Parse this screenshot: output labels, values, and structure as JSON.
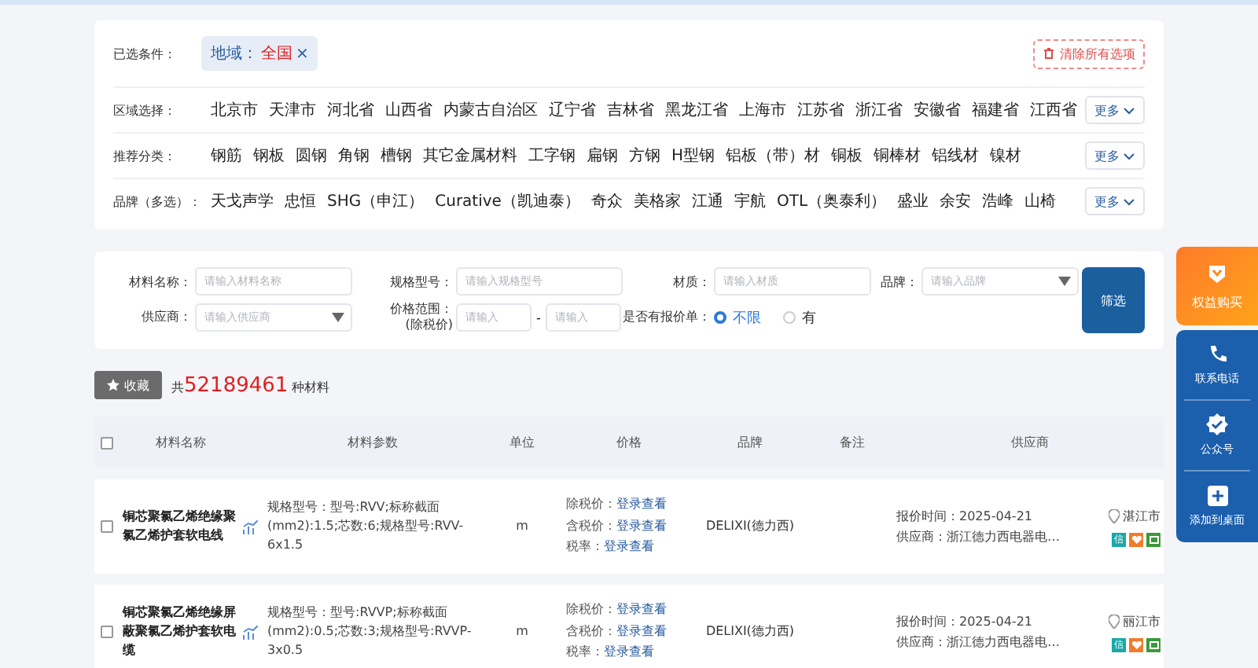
{
  "selected_conditions": {
    "label": "已选条件：",
    "tags": [
      {
        "key": "地域：",
        "value": "全国"
      }
    ],
    "close_glyph": "×",
    "clear_button": "清除所有选项"
  },
  "filter_rows": [
    {
      "label": "区域选择：",
      "options": [
        "北京市",
        "天津市",
        "河北省",
        "山西省",
        "内蒙古自治区",
        "辽宁省",
        "吉林省",
        "黑龙江省",
        "上海市",
        "江苏省",
        "浙江省",
        "安徽省",
        "福建省",
        "江西省"
      ],
      "more": "更多"
    },
    {
      "label": "推荐分类：",
      "options": [
        "钢筋",
        "钢板",
        "圆钢",
        "角钢",
        "槽钢",
        "其它金属材料",
        "工字钢",
        "扁钢",
        "方钢",
        "H型钢",
        "铝板（带）材",
        "铜板",
        "铜棒材",
        "铝线材",
        "镍材"
      ],
      "more": "更多"
    },
    {
      "label": "品牌（多选）：",
      "options": [
        "天戈声学",
        "忠恒",
        "SHG（申江）",
        "Curative（凯迪泰）",
        "奇众",
        "美格家",
        "江通",
        "宇航",
        "OTL（奥泰利）",
        "盛业",
        "余安",
        "浩峰",
        "山椅"
      ],
      "more": "更多"
    }
  ],
  "search_form": {
    "fields": [
      {
        "label": "材料名称：",
        "placeholder": "请输入材料名称",
        "kind": "text"
      },
      {
        "label": "规格型号：",
        "placeholder": "请输入规格型号",
        "kind": "text"
      },
      {
        "label": "材质：",
        "placeholder": "请输入材质",
        "kind": "text"
      },
      {
        "label": "品牌：",
        "placeholder": "请输入品牌",
        "kind": "select"
      },
      {
        "label": "供应商：",
        "placeholder": "请输入供应商",
        "kind": "select"
      }
    ],
    "price_range": {
      "label": "价格范围：",
      "sublabel": "(除税价)",
      "min_placeholder": "请输入",
      "separator": "-",
      "max_placeholder": "请输入"
    },
    "quote_filter": {
      "label": "是否有报价单：",
      "options": [
        {
          "label": "不限",
          "selected": true
        },
        {
          "label": "有",
          "selected": false
        }
      ]
    },
    "submit": "筛选"
  },
  "toolbar": {
    "favorite_button": "收藏",
    "count_prefix": "共",
    "count": "52189461",
    "count_suffix": "种材料"
  },
  "table": {
    "select_all_checked": false,
    "columns": [
      "材料名称",
      "材料参数",
      "单位",
      "价格",
      "品牌",
      "备注",
      "供应商"
    ],
    "rows": [
      {
        "checked": false,
        "name": "铜芯聚氯乙烯绝缘聚氯乙烯护套软电线",
        "params": "规格型号：型号:RVV;标称截面(mm2):1.5;芯数:6;规格型号:RVV-6x1.5",
        "unit": "m",
        "prices": [
          {
            "label": "除税价：",
            "link": "登录查看"
          },
          {
            "label": "含税价：",
            "link": "登录查看"
          },
          {
            "label": "税率：",
            "link": "登录查看"
          }
        ],
        "brand": "DELIXI(德力西)",
        "quote_time": "报价时间：2025-04-21",
        "supplier": "供应商：浙江德力西电器电…",
        "city": "湛江市",
        "badge_text": "信"
      },
      {
        "checked": false,
        "name": "铜芯聚氯乙烯绝缘屏蔽聚氯乙烯护套软电缆",
        "params": "规格型号：型号:RVVP;标称截面(mm2):0.5;芯数:3;规格型号:RVVP-3x0.5",
        "unit": "m",
        "prices": [
          {
            "label": "除税价：",
            "link": "登录查看"
          },
          {
            "label": "含税价：",
            "link": "登录查看"
          },
          {
            "label": "税率：",
            "link": "登录查看"
          }
        ],
        "brand": "DELIXI(德力西)",
        "quote_time": "报价时间：2025-04-21",
        "supplier": "供应商：浙江德力西电器电…",
        "city": "丽江市",
        "badge_text": "信"
      }
    ]
  },
  "side_panel": [
    {
      "label": "权益购买",
      "kind": "benefit"
    },
    {
      "label": "联系电话",
      "kind": "phone"
    },
    {
      "label": "公众号",
      "kind": "badge"
    },
    {
      "label": "添加到桌面",
      "kind": "add"
    }
  ]
}
